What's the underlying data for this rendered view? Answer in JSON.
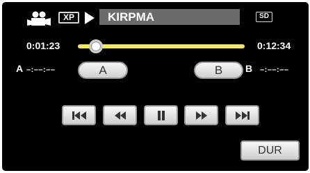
{
  "header": {
    "mode_icon": "video-camera-icon",
    "quality": "XP",
    "state_icon": "play-icon",
    "title": "KIRPMA",
    "resolution": "SD"
  },
  "timeline": {
    "current_time": "0:01:23",
    "total_time": "0:12:34",
    "position_fraction": 0.11,
    "track_color": "#f2e95c"
  },
  "ab_repeat": {
    "a_label": "A",
    "a_value": "–:––:––",
    "a_button": "A",
    "b_label": "B",
    "b_value": "–:––:––",
    "b_button": "B"
  },
  "controls": {
    "skip_back_icon": "skip-back-icon",
    "rewind_icon": "rewind-icon",
    "pause_icon": "pause-icon",
    "fast_forward_icon": "fast-forward-icon",
    "skip_forward_icon": "skip-forward-icon"
  },
  "footer": {
    "dur_button": "DUR"
  }
}
